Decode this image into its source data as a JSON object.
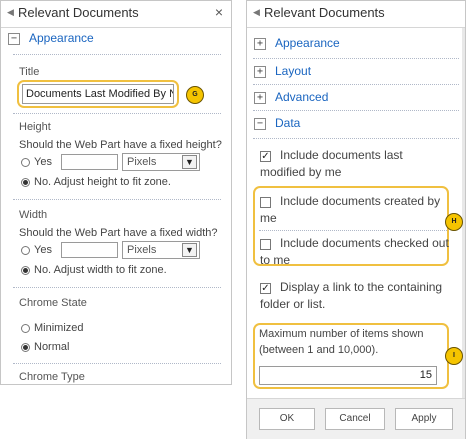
{
  "left_panel": {
    "title": "Relevant Documents",
    "close_glyph": "×",
    "appearance_section": {
      "toggle": "−",
      "label": "Appearance"
    },
    "title_field": {
      "label": "Title",
      "value": "Documents Last Modified By N",
      "badge": "G"
    },
    "height": {
      "label": "Height",
      "question": "Should the Web Part have a fixed height?",
      "yes_label": "Yes",
      "unit": "Pixels",
      "no_label": "No. Adjust height to fit zone."
    },
    "width": {
      "label": "Width",
      "question": "Should the Web Part have a fixed width?",
      "yes_label": "Yes",
      "unit": "Pixels",
      "no_label": "No. Adjust width to fit zone."
    },
    "chrome_state": {
      "label": "Chrome State",
      "minimized_label": "Minimized",
      "normal_label": "Normal"
    },
    "chrome_type_label": "Chrome Type"
  },
  "right_panel": {
    "title": "Relevant Documents",
    "sections": [
      {
        "toggle": "+",
        "label": "Appearance"
      },
      {
        "toggle": "+",
        "label": "Layout"
      },
      {
        "toggle": "+",
        "label": "Advanced"
      },
      {
        "toggle": "−",
        "label": "Data"
      }
    ],
    "options": {
      "include_last_modified": {
        "line1": "Include documents last",
        "line2": "modified by me",
        "checked": true
      },
      "include_created": {
        "line1": "Include documents created by",
        "line2": "me",
        "checked": false
      },
      "include_checked_out": {
        "line1": "Include documents checked out",
        "line2": "to me",
        "checked": false
      },
      "display_link": {
        "line1": "Display a link to the containing",
        "line2": "folder or list.",
        "checked": true
      }
    },
    "max_items": {
      "line1": "Maximum number of items shown",
      "line2": "(between 1 and 10,000).",
      "value": "15"
    },
    "badges": {
      "h": "H",
      "i": "I"
    },
    "buttons": {
      "ok": "OK",
      "cancel": "Cancel",
      "apply": "Apply"
    }
  },
  "colors": {
    "accent_link": "#1a65c0",
    "highlight": "#f0c040",
    "badge_fill": "#f5c400"
  },
  "icons": {
    "collapse": "minus-box-icon",
    "expand": "plus-box-icon",
    "close": "close-icon",
    "dropdown": "chevron-down-icon",
    "header_arrow": "small-left-arrow-icon"
  }
}
